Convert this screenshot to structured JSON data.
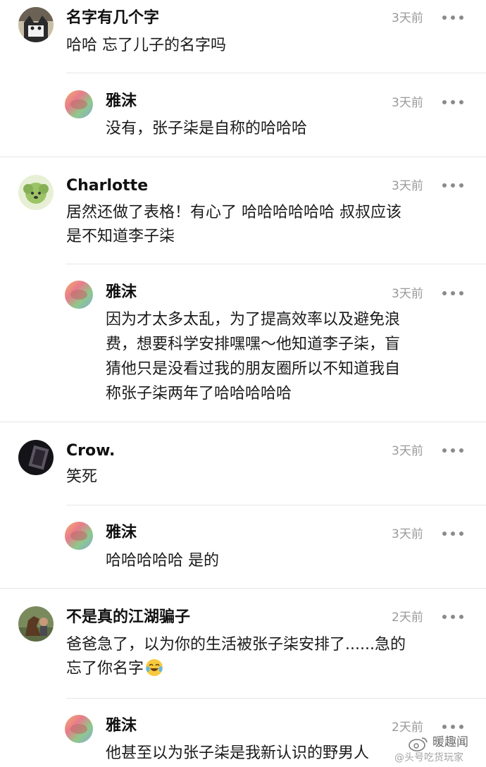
{
  "comments": [
    {
      "avatar": "cat-avatar",
      "name": "名字有几个字",
      "time": "3天前",
      "lines": [
        "哈哈 忘了儿子的名字吗"
      ]
    },
    {
      "avatar": "rainbow-avatar",
      "name": "雅沫",
      "time": "3天前",
      "lines": [
        "没有，张子柒是自称的哈哈哈"
      ]
    },
    {
      "avatar": "puppy-avatar",
      "name": "Charlotte",
      "time": "3天前",
      "lines": [
        "居然还做了表格！有心了 哈哈哈哈哈哈 叔叔应该",
        "是不知道李子柒"
      ]
    },
    {
      "avatar": "rainbow-avatar",
      "name": "雅沫",
      "time": "3天前",
      "lines": [
        "因为才太多太乱，为了提高效率以及避免浪",
        "费，想要科学安排嘿嘿～他知道李子柒，盲",
        "猜他只是没看过我的朋友圈所以不知道我自",
        "称张子柒两年了哈哈哈哈哈"
      ]
    },
    {
      "avatar": "dark-avatar",
      "name": "Crow.",
      "time": "3天前",
      "lines": [
        "笑死"
      ]
    },
    {
      "avatar": "rainbow-avatar",
      "name": "雅沫",
      "time": "3天前",
      "lines": [
        "哈哈哈哈哈 是的"
      ]
    },
    {
      "avatar": "horse-avatar",
      "name": "不是真的江湖骗子",
      "time": "2天前",
      "lines": [
        "爸爸急了，以为你的生活被张子柒安排了......急的",
        "忘了你名字"
      ],
      "trailing_icon": "laughing-crying-emoji-icon"
    },
    {
      "avatar": "rainbow-avatar",
      "name": "雅沫",
      "time": "2天前",
      "lines": [
        "他甚至以为张子柒是我新认识的野男人"
      ]
    }
  ],
  "watermark": {
    "main": "暖趣闻",
    "sub": "@头号吃货玩家",
    "icon": "weibo-logo-icon"
  },
  "icons": {
    "more": "more-options-icon"
  },
  "colors": {
    "time": "#9a9a9a",
    "divider": "#e6e6e6",
    "more_dots": "#8a8a8a"
  }
}
